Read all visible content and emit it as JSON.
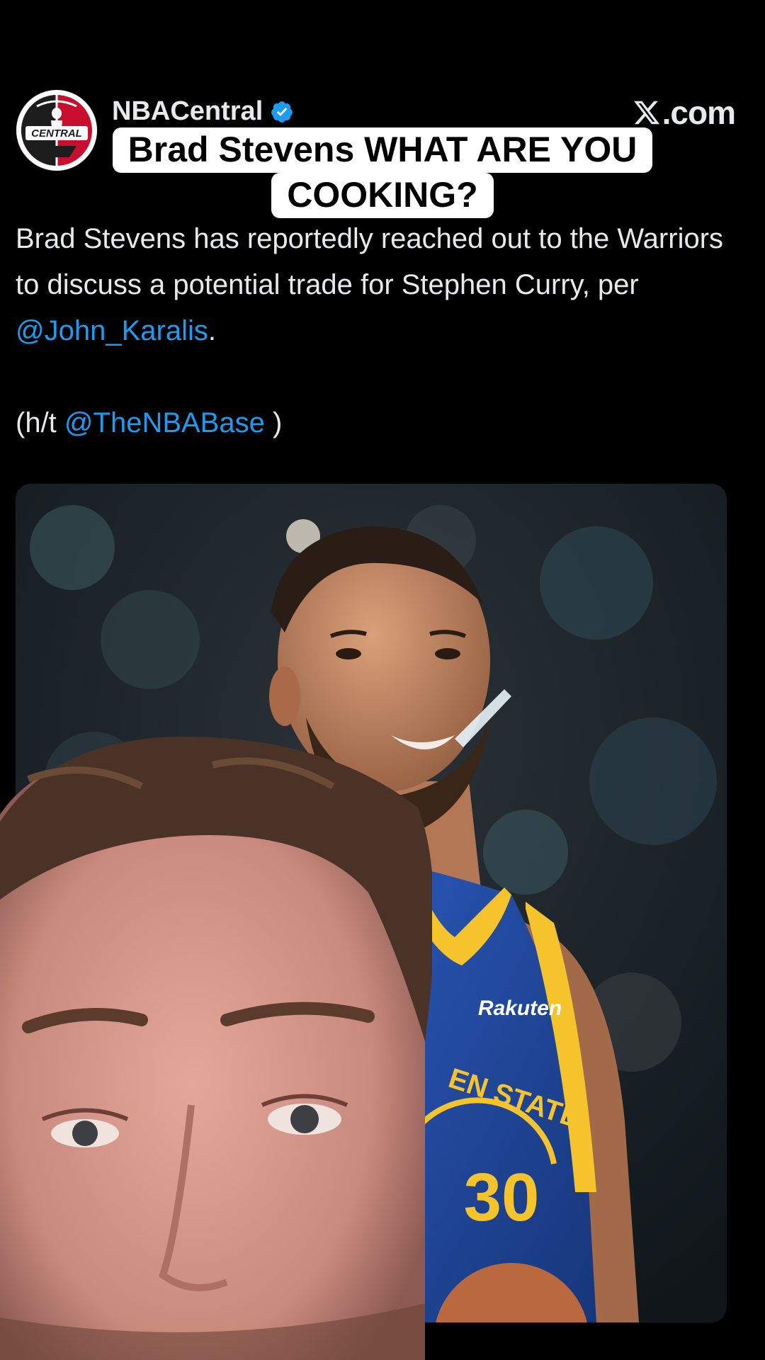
{
  "post": {
    "author_name": "NBACentral",
    "avatar_text": "CENTRAL",
    "handle_stub": "@",
    "source_label": ".com",
    "text_line1_pre": "Brad Stevens has reportedly reached out to the Warriors to discuss a potential trade for Stephen Curry, per ",
    "mention1": "@John_Karalis",
    "text_line1_post": ".",
    "text_line2_pre": "(h/t ",
    "mention2": "@TheNBABase",
    "text_line2_post": " )"
  },
  "caption": {
    "line1": "Brad Stevens WHAT ARE YOU",
    "line2": "COOKING?"
  },
  "media": {
    "jersey_sponsor": "Rakuten",
    "jersey_team_text": "EN STATE",
    "jersey_number": "30"
  },
  "colors": {
    "background": "#000000",
    "text": "#e7e9ea",
    "mention": "#1d9bf0",
    "verified": "#1d9bf0",
    "caption_bg": "#ffffff",
    "jersey_blue": "#1d428a",
    "jersey_gold": "#ffc72c"
  },
  "icons": [
    "verified-badge-icon",
    "x-logo-icon"
  ]
}
